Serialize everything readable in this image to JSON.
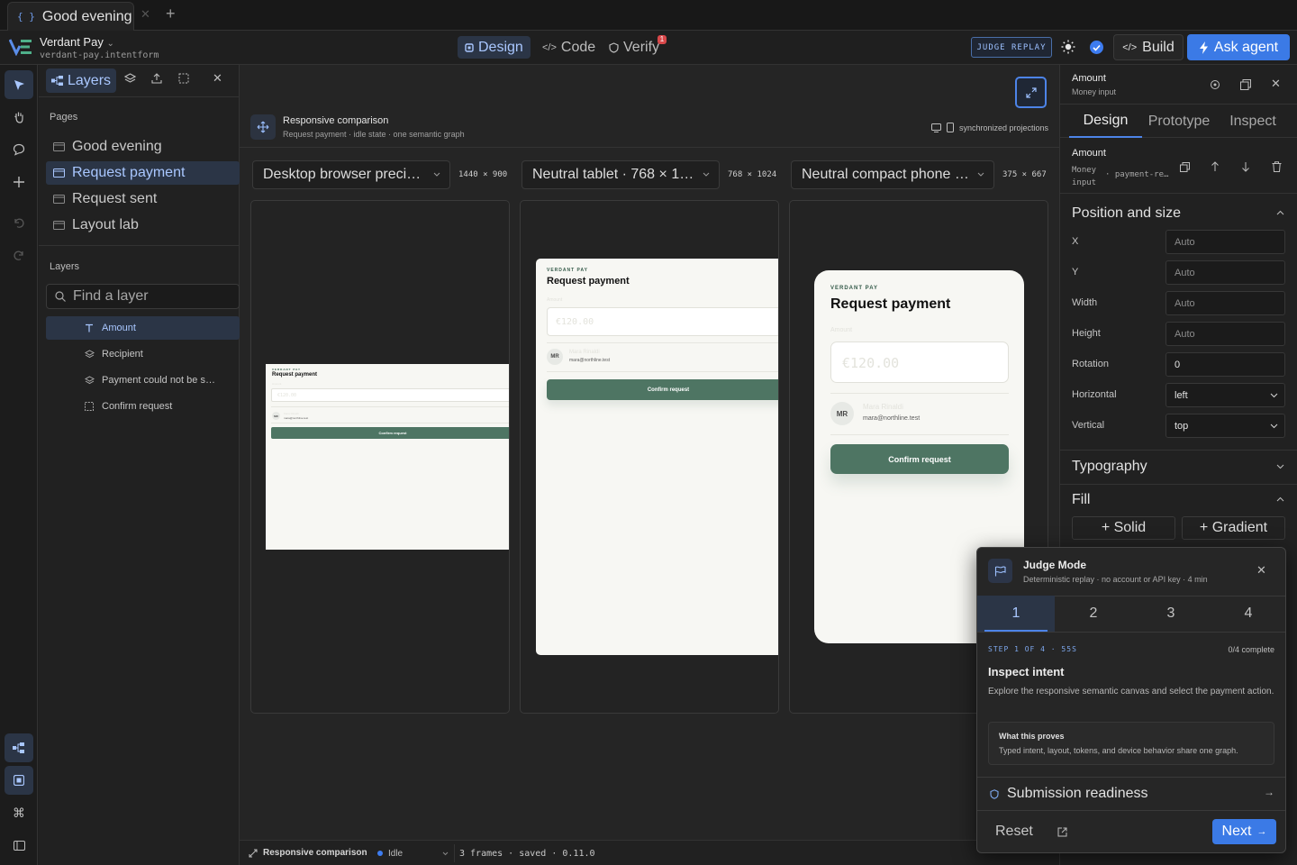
{
  "tab": {
    "title": "Good evening"
  },
  "project": {
    "name": "Verdant Pay",
    "file": "verdant-pay.intentform"
  },
  "modes": {
    "design": "Design",
    "code": "Code",
    "verify": "Verify",
    "verify_badge": "1"
  },
  "header": {
    "judge_replay": "JUDGE REPLAY",
    "build": "Build",
    "ask_agent": "Ask agent"
  },
  "layers_panel": {
    "tab_label": "Layers",
    "pages_title": "Pages",
    "pages": [
      "Good evening",
      "Request payment",
      "Request sent",
      "Layout lab"
    ],
    "selected_page": "Request payment",
    "layers_title": "Layers",
    "search_placeholder": "Find a layer",
    "layers": [
      "Amount",
      "Recipient",
      "Payment could not be s…",
      "Confirm request"
    ]
  },
  "canvas": {
    "title": "Responsive comparison",
    "subtitle": "Request payment · idle state · one semantic graph",
    "sync_label": "synchronized projections",
    "devices": [
      {
        "label": "Desktop browser preci…",
        "dims": "1440 × 900"
      },
      {
        "label": "Neutral tablet · 768 × 1…",
        "dims": "768 × 1024"
      },
      {
        "label": "Neutral compact phone …",
        "dims": "375 × 667"
      }
    ],
    "mockup": {
      "brand": "VERDANT PAY",
      "title": "Request payment",
      "amount_label": "Amount",
      "amount_placeholder": "€120.00",
      "avatar": "MR",
      "recipient_name": "Mara Rinaldi",
      "recipient_email": "mara@northline.test",
      "button": "Confirm request"
    }
  },
  "status": {
    "title": "Responsive comparison",
    "state": "Idle",
    "info": "3 frames · saved · 0.11.0"
  },
  "inspector": {
    "title": "Amount",
    "subtitle": "Money input",
    "tabs": [
      "Design",
      "Prototype",
      "Inspect"
    ],
    "element_name": "Amount",
    "element_type": "Money input",
    "element_id": "· payment-re…",
    "position_title": "Position and size",
    "fields": [
      {
        "label": "X",
        "value": "Auto"
      },
      {
        "label": "Y",
        "value": "Auto"
      },
      {
        "label": "Width",
        "value": "Auto"
      },
      {
        "label": "Height",
        "value": "Auto"
      },
      {
        "label": "Rotation",
        "value": "0"
      },
      {
        "label": "Horizontal",
        "value": "left"
      },
      {
        "label": "Vertical",
        "value": "top"
      }
    ],
    "typography_title": "Typography",
    "fill_title": "Fill",
    "fill_solid": "+ Solid",
    "fill_gradient": "+ Gradient"
  },
  "judge_mode": {
    "title": "Judge Mode",
    "subtitle": "Deterministic replay · no account or API key · 4 min",
    "steps": [
      "1",
      "2",
      "3",
      "4"
    ],
    "step_label": "STEP 1 OF 4 · 55S",
    "complete": "0/4 complete",
    "heading": "Inspect intent",
    "body": "Explore the responsive semantic canvas and select the payment action.",
    "proves_title": "What this proves",
    "proves_body": "Typed intent, layout, tokens, and device behavior share one graph.",
    "readiness": "Submission readiness",
    "reset": "Reset",
    "next": "Next"
  },
  "colors": {
    "accent": "#3b7ae6",
    "brand_green": "#4e7563",
    "selected_bg": "#2b3546"
  }
}
